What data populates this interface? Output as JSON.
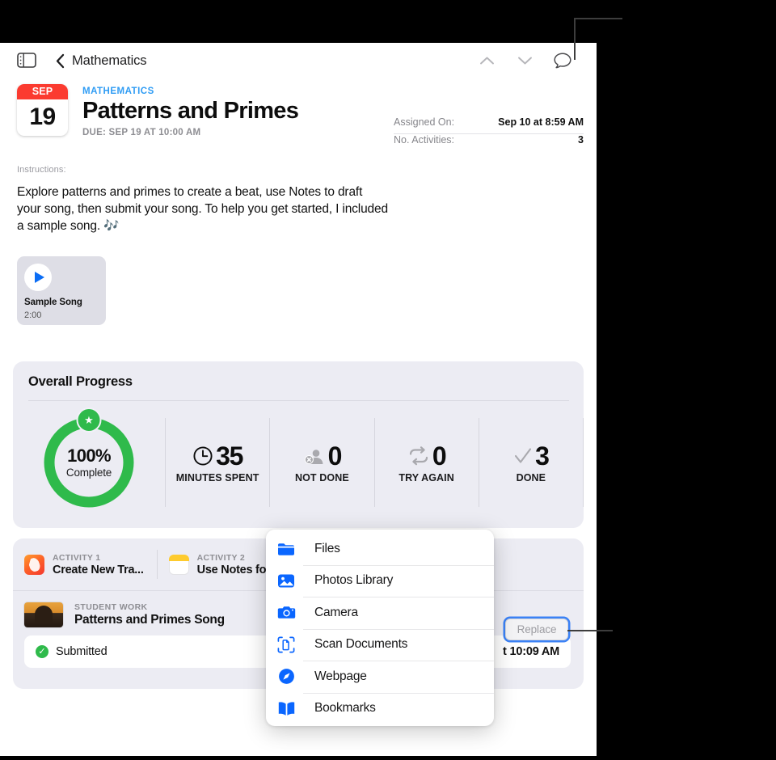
{
  "toolbar": {
    "sidebar_toggle_name": "sidebar-toggle-icon",
    "back_label": "Mathematics",
    "up_icon": "chevron-up-icon",
    "down_icon": "chevron-down-icon",
    "comment_icon": "comment-bubble-icon"
  },
  "header": {
    "calendar_month": "SEP",
    "calendar_day": "19",
    "subject": "MATHEMATICS",
    "title": "Patterns and Primes",
    "due": "DUE: SEP 19 AT 10:00 AM"
  },
  "meta": {
    "rows": [
      {
        "key": "Assigned On:",
        "value": "Sep 10 at 8:59 AM"
      },
      {
        "key": "No. Activities:",
        "value": "3"
      }
    ]
  },
  "instructions": {
    "label": "Instructions:",
    "body": "Explore patterns and primes to create a beat, use Notes to draft your song, then submit your song. To help you get started, I included a sample song. 🎶"
  },
  "attachment": {
    "title": "Sample Song",
    "duration": "2:00",
    "play_icon": "play-icon"
  },
  "progress": {
    "title": "Overall Progress",
    "ring_percent": "100%",
    "ring_percent_value": 100,
    "ring_sub": "Complete",
    "ring_color": "#2fba4b",
    "star_icon": "star-icon",
    "stats": [
      {
        "icon": "clock-icon",
        "value": "35",
        "label": "MINUTES SPENT"
      },
      {
        "icon": "person-badge-x-icon",
        "value": "0",
        "label": "NOT DONE"
      },
      {
        "icon": "repeat-arrows-icon",
        "value": "0",
        "label": "TRY AGAIN"
      },
      {
        "icon": "checkmark-icon",
        "value": "3",
        "label": "DONE"
      }
    ]
  },
  "activities": {
    "tabs": [
      {
        "icon": "garageband-app-icon",
        "label": "ACTIVITY 1",
        "title": "Create New Tra..."
      },
      {
        "icon": "notes-app-icon",
        "label": "ACTIVITY 2",
        "title": "Use Notes fo"
      }
    ],
    "student_work": {
      "thumb_icon": "garageband-project-thumbnail",
      "label": "STUDENT WORK",
      "title": "Patterns and Primes Song"
    },
    "submitted": {
      "status_icon": "check-circle-icon",
      "status": "Submitted",
      "time": "t 10:09 AM"
    },
    "replace_button": "Replace"
  },
  "popup_menu": {
    "items": [
      {
        "icon": "folder-icon",
        "label": "Files"
      },
      {
        "icon": "photos-icon",
        "label": "Photos Library"
      },
      {
        "icon": "camera-icon",
        "label": "Camera"
      },
      {
        "icon": "scan-documents-icon",
        "label": "Scan Documents"
      },
      {
        "icon": "compass-icon",
        "label": "Webpage"
      },
      {
        "icon": "bookmarks-icon",
        "label": "Bookmarks"
      }
    ]
  },
  "colors": {
    "accent_blue": "#0a66ff",
    "link_blue": "#2f9cf4",
    "calendar_red": "#fb3b30",
    "green": "#2fba4b",
    "card_bg": "#ececf3",
    "focus_ring": "#3b82f6"
  }
}
